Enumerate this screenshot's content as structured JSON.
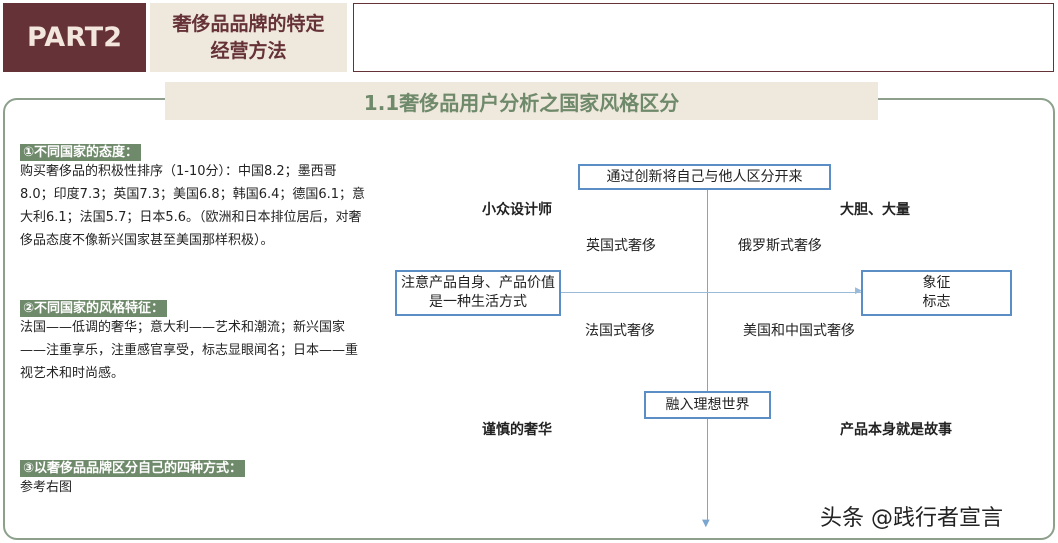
{
  "header": {
    "part": "PART2",
    "subtitle_line1": "奢侈品品牌的特定",
    "subtitle_line2": "经营方法"
  },
  "title": "1.1奢侈品用户分析之国家风格区分",
  "sections": [
    {
      "heading": "①不同国家的态度：",
      "body": "购买奢侈品的积极性排序（1-10分）：中国8.2；墨西哥8.0；印度7.3；英国7.3；美国6.8；韩国6.4；德国6.1；意大利6.1；法国5.7；日本5.6。（欧洲和日本排位居后，对奢侈品态度不像新兴国家甚至美国那样积极）。"
    },
    {
      "heading": "②不同国家的风格特征：",
      "body": "法国——低调的奢华；意大利——艺术和潮流；新兴国家——注重享乐，注重感官享受，标志显眼闻名；日本——重视艺术和时尚感。"
    },
    {
      "heading": "③以奢侈品品牌区分自己的四种方式：",
      "body": "参考右图"
    }
  ],
  "diagram": {
    "top_box": "通过创新将自己与他人区分开来",
    "bottom_box": "融入理想世界",
    "left_box": "注意产品自身、产品价值是一种生活方式",
    "right_box_line1": "象征",
    "right_box_line2": "标志",
    "top_left": "小众设计师",
    "top_right": "大胆、大量",
    "bottom_left": "谨慎的奢华",
    "bottom_right": "产品本身就是故事",
    "q_tl": "英国式奢侈",
    "q_tr": "俄罗斯式奢侈",
    "q_bl": "法国式奢侈",
    "q_br": "美国和中国式奢侈"
  },
  "watermark": "头条 @践行者宣言"
}
